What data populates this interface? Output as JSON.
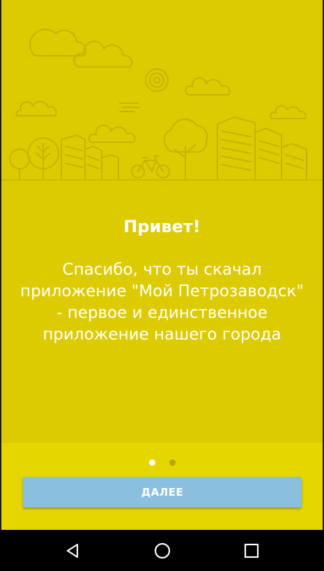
{
  "welcome": {
    "title": "Привет!",
    "message": "Спасибо, что ты скачал\nприложение \"Мой Петрозаводск\"\n- первое и единственное\nприложение нашего города"
  },
  "pager": {
    "current_page": 1,
    "page_count": 2
  },
  "actions": {
    "next_label": "ДАЛЕЕ"
  },
  "navbar": {
    "back_icon": "back-icon",
    "home_icon": "home-icon",
    "recents_icon": "recents-icon"
  },
  "colors": {
    "background": "#dccb00",
    "bottom_panel": "#e5d600",
    "button": "#8bbfe0",
    "text": "#ffffff"
  }
}
